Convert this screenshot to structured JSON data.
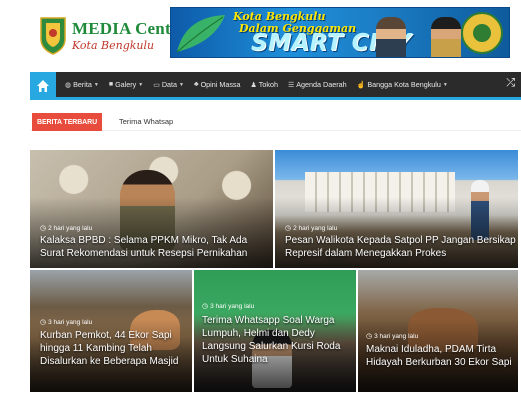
{
  "header": {
    "logo": {
      "line1": "MEDIA Center",
      "line2": "Kota Bengkulu"
    },
    "banner": {
      "title_line1": "Kota Bengkulu",
      "title_line2": "Dalam Genggaman",
      "big": "SMART CITY"
    }
  },
  "nav": {
    "home_icon": "home-icon",
    "items": [
      {
        "label": "Berita",
        "icon": "globe",
        "dropdown": true
      },
      {
        "label": "Galery",
        "icon": "camera",
        "dropdown": true
      },
      {
        "label": "Data",
        "icon": "calendar",
        "dropdown": true
      },
      {
        "label": "Opini Massa",
        "icon": "users",
        "dropdown": false
      },
      {
        "label": "Tokoh",
        "icon": "user",
        "dropdown": false
      },
      {
        "label": "Agenda Daerah",
        "icon": "list",
        "dropdown": false
      },
      {
        "label": "Bangga Kota Bengkulu",
        "icon": "thumbs-up",
        "dropdown": true
      }
    ],
    "shuffle_icon": "shuffle-icon"
  },
  "ticker": {
    "label": "BERITA TERBARU",
    "text": "Terima Whatsap"
  },
  "colors": {
    "nav_bg": "#2b2b2b",
    "accent": "#28a8e0",
    "ticker_red": "#e74c3c"
  },
  "cards": [
    {
      "meta": "2 hari yang lalu",
      "title": "Kalaksa BPBD : Selama PPKM Mikro, Tak Ada Surat Rekomendasi untuk Resepsi Pernikahan"
    },
    {
      "meta": "2 hari yang lalu",
      "title": "Pesan Walikota Kepada Satpol PP Jangan Bersikap Represif dalam Menegakkan Prokes"
    },
    {
      "meta": "3 hari yang lalu",
      "title": "Kurban Pemkot, 44 Ekor Sapi hingga 11 Kambing Telah Disalurkan ke Beberapa Masjid"
    },
    {
      "meta": "3 hari yang lalu",
      "title": "Terima Whatsapp Soal Warga Lumpuh, Helmi dan Dedy Langsung Salurkan Kursi Roda Untuk Suhaina"
    },
    {
      "meta": "3 hari yang lalu",
      "title": "Maknai Iduladha, PDAM Tirta Hidayah Berkurban 30 Ekor Sapi"
    }
  ]
}
